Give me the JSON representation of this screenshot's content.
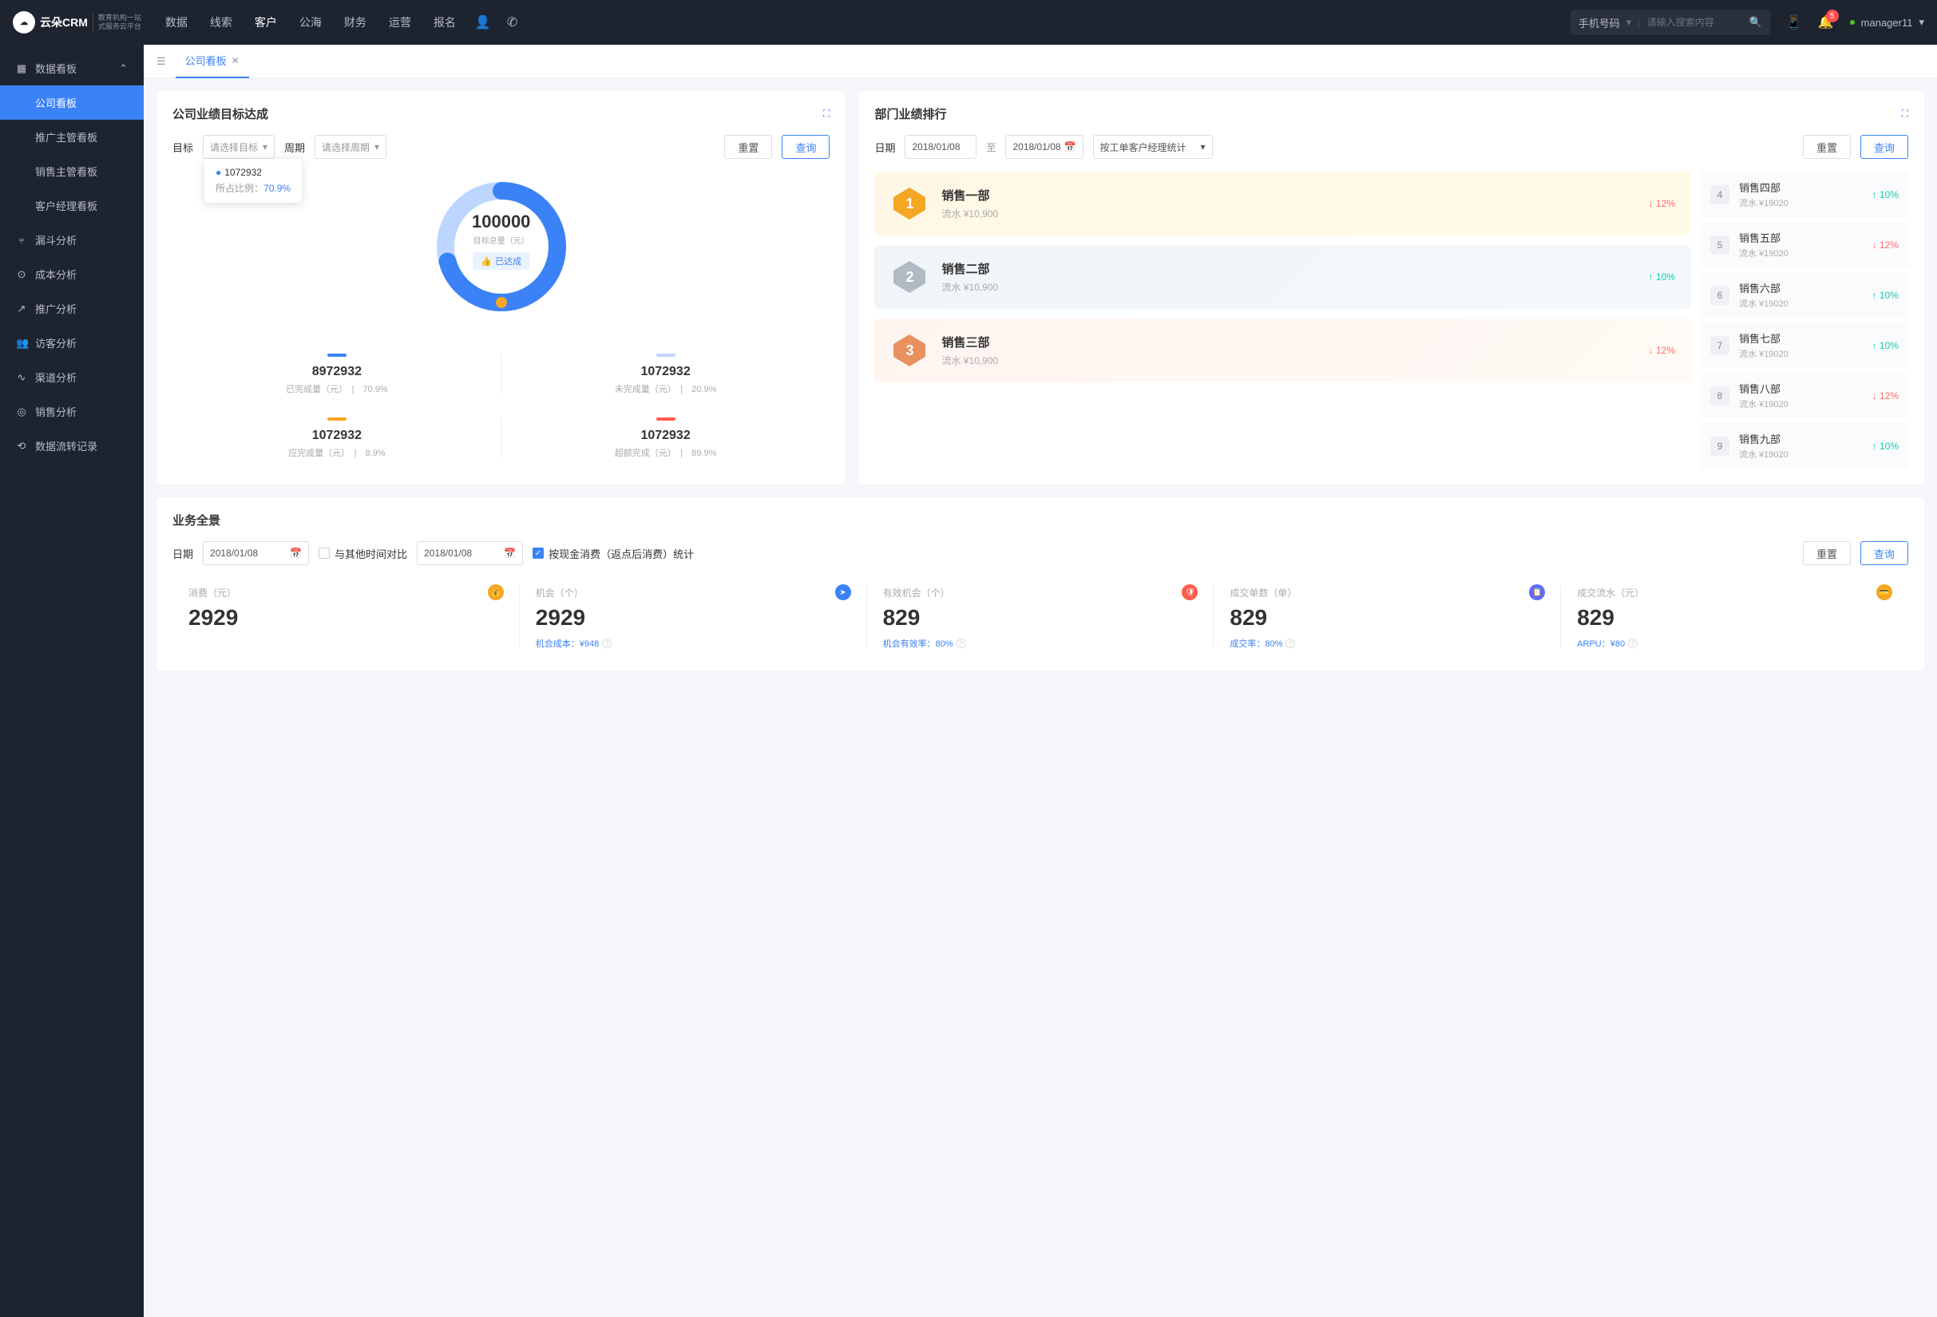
{
  "header": {
    "logo_brand": "云朵CRM",
    "logo_sub1": "教育机构一站",
    "logo_sub2": "式服务云平台",
    "nav": [
      "数据",
      "线索",
      "客户",
      "公海",
      "财务",
      "运营",
      "报名"
    ],
    "nav_active": 2,
    "search_type": "手机号码",
    "search_placeholder": "请输入搜索内容",
    "badge": "5",
    "user": "manager11"
  },
  "sidebar": {
    "group": "数据看板",
    "subs": [
      "公司看板",
      "推广主管看板",
      "销售主管看板",
      "客户经理看板"
    ],
    "items": [
      "漏斗分析",
      "成本分析",
      "推广分析",
      "访客分析",
      "渠道分析",
      "销售分析",
      "数据流转记录"
    ]
  },
  "tab": {
    "label": "公司看板"
  },
  "goal": {
    "title": "公司业绩目标达成",
    "target_label": "目标",
    "target_placeholder": "请选择目标",
    "period_label": "周期",
    "period_placeholder": "请选择周期",
    "reset": "重置",
    "query": "查询",
    "tooltip_value": "1072932",
    "tooltip_ratio_label": "所占比例：",
    "tooltip_ratio": "70.9%",
    "center_value": "100000",
    "center_label": "目标总量（元）",
    "achieved": "已达成",
    "stats": [
      {
        "bar": "#3b82f6",
        "val": "8972932",
        "label": "已完成量（元）",
        "pct": "70.9%"
      },
      {
        "bar": "#bcd6ff",
        "val": "1072932",
        "label": "未完成量（元）",
        "pct": "20.9%"
      },
      {
        "bar": "#f5a623",
        "val": "1072932",
        "label": "应完成量（元）",
        "pct": "8.9%"
      },
      {
        "bar": "#ff5b4c",
        "val": "1072932",
        "label": "超额完成（元）",
        "pct": "89.9%"
      }
    ]
  },
  "rank": {
    "title": "部门业绩排行",
    "date_label": "日期",
    "date1": "2018/01/08",
    "date_to": "至",
    "date2": "2018/01/08",
    "stat_by": "按工单客户经理统计",
    "reset": "重置",
    "query": "查询",
    "top": [
      {
        "name": "销售一部",
        "sub": "流水 ¥10,900",
        "trend": "12%",
        "dir": "down"
      },
      {
        "name": "销售二部",
        "sub": "流水 ¥10,900",
        "trend": "10%",
        "dir": "up"
      },
      {
        "name": "销售三部",
        "sub": "流水 ¥10,900",
        "trend": "12%",
        "dir": "down"
      }
    ],
    "list": [
      {
        "n": "4",
        "name": "销售四部",
        "sub": "流水 ¥19020",
        "trend": "10%",
        "dir": "up"
      },
      {
        "n": "5",
        "name": "销售五部",
        "sub": "流水 ¥19020",
        "trend": "12%",
        "dir": "down"
      },
      {
        "n": "6",
        "name": "销售六部",
        "sub": "流水 ¥19020",
        "trend": "10%",
        "dir": "up"
      },
      {
        "n": "7",
        "name": "销售七部",
        "sub": "流水 ¥19020",
        "trend": "10%",
        "dir": "up"
      },
      {
        "n": "8",
        "name": "销售八部",
        "sub": "流水 ¥19020",
        "trend": "12%",
        "dir": "down"
      },
      {
        "n": "9",
        "name": "销售九部",
        "sub": "流水 ¥19020",
        "trend": "10%",
        "dir": "up"
      }
    ]
  },
  "biz": {
    "title": "业务全景",
    "date_label": "日期",
    "date1": "2018/01/08",
    "compare_label": "与其他时间对比",
    "date2": "2018/01/08",
    "check_label": "按现金消费（返点后消费）统计",
    "reset": "重置",
    "query": "查询",
    "kpis": [
      {
        "label": "消费（元）",
        "val": "2929",
        "icon": "#f5a623",
        "sub": ""
      },
      {
        "label": "机会（个）",
        "val": "2929",
        "icon": "#3b82f6",
        "sub": "机会成本：¥948"
      },
      {
        "label": "有效机会（个）",
        "val": "829",
        "icon": "#ff5b4c",
        "sub": "机会有效率：80%"
      },
      {
        "label": "成交单数（单）",
        "val": "829",
        "icon": "#5b6eff",
        "sub": "成交率：80%"
      },
      {
        "label": "成交流水（元）",
        "val": "829",
        "icon": "#f5a623",
        "sub": "ARPU：¥80"
      }
    ]
  },
  "chart_data": {
    "type": "pie",
    "title": "公司业绩目标达成",
    "total": 100000,
    "series": [
      {
        "name": "已完成量（元）",
        "value": 8972932,
        "pct": 70.9,
        "color": "#3b82f6"
      },
      {
        "name": "未完成量（元）",
        "value": 1072932,
        "pct": 20.9,
        "color": "#bcd6ff"
      },
      {
        "name": "应完成量（元）",
        "value": 1072932,
        "pct": 8.9,
        "color": "#f5a623"
      },
      {
        "name": "超额完成（元）",
        "value": 1072932,
        "pct": 89.9,
        "color": "#ff5b4c"
      }
    ]
  }
}
